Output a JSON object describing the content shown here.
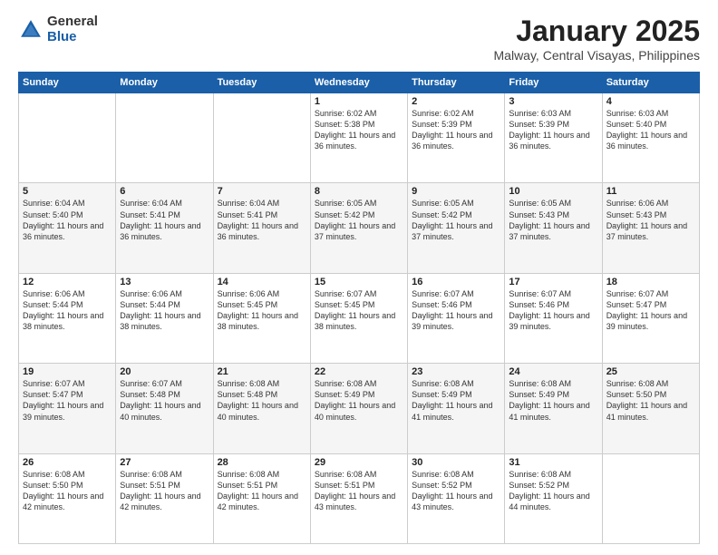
{
  "header": {
    "logo_general": "General",
    "logo_blue": "Blue",
    "month_title": "January 2025",
    "location": "Malway, Central Visayas, Philippines"
  },
  "days_of_week": [
    "Sunday",
    "Monday",
    "Tuesday",
    "Wednesday",
    "Thursday",
    "Friday",
    "Saturday"
  ],
  "weeks": [
    [
      {
        "day": "",
        "sunrise": "",
        "sunset": "",
        "daylight": ""
      },
      {
        "day": "",
        "sunrise": "",
        "sunset": "",
        "daylight": ""
      },
      {
        "day": "",
        "sunrise": "",
        "sunset": "",
        "daylight": ""
      },
      {
        "day": "1",
        "sunrise": "Sunrise: 6:02 AM",
        "sunset": "Sunset: 5:38 PM",
        "daylight": "Daylight: 11 hours and 36 minutes."
      },
      {
        "day": "2",
        "sunrise": "Sunrise: 6:02 AM",
        "sunset": "Sunset: 5:39 PM",
        "daylight": "Daylight: 11 hours and 36 minutes."
      },
      {
        "day": "3",
        "sunrise": "Sunrise: 6:03 AM",
        "sunset": "Sunset: 5:39 PM",
        "daylight": "Daylight: 11 hours and 36 minutes."
      },
      {
        "day": "4",
        "sunrise": "Sunrise: 6:03 AM",
        "sunset": "Sunset: 5:40 PM",
        "daylight": "Daylight: 11 hours and 36 minutes."
      }
    ],
    [
      {
        "day": "5",
        "sunrise": "Sunrise: 6:04 AM",
        "sunset": "Sunset: 5:40 PM",
        "daylight": "Daylight: 11 hours and 36 minutes."
      },
      {
        "day": "6",
        "sunrise": "Sunrise: 6:04 AM",
        "sunset": "Sunset: 5:41 PM",
        "daylight": "Daylight: 11 hours and 36 minutes."
      },
      {
        "day": "7",
        "sunrise": "Sunrise: 6:04 AM",
        "sunset": "Sunset: 5:41 PM",
        "daylight": "Daylight: 11 hours and 36 minutes."
      },
      {
        "day": "8",
        "sunrise": "Sunrise: 6:05 AM",
        "sunset": "Sunset: 5:42 PM",
        "daylight": "Daylight: 11 hours and 37 minutes."
      },
      {
        "day": "9",
        "sunrise": "Sunrise: 6:05 AM",
        "sunset": "Sunset: 5:42 PM",
        "daylight": "Daylight: 11 hours and 37 minutes."
      },
      {
        "day": "10",
        "sunrise": "Sunrise: 6:05 AM",
        "sunset": "Sunset: 5:43 PM",
        "daylight": "Daylight: 11 hours and 37 minutes."
      },
      {
        "day": "11",
        "sunrise": "Sunrise: 6:06 AM",
        "sunset": "Sunset: 5:43 PM",
        "daylight": "Daylight: 11 hours and 37 minutes."
      }
    ],
    [
      {
        "day": "12",
        "sunrise": "Sunrise: 6:06 AM",
        "sunset": "Sunset: 5:44 PM",
        "daylight": "Daylight: 11 hours and 38 minutes."
      },
      {
        "day": "13",
        "sunrise": "Sunrise: 6:06 AM",
        "sunset": "Sunset: 5:44 PM",
        "daylight": "Daylight: 11 hours and 38 minutes."
      },
      {
        "day": "14",
        "sunrise": "Sunrise: 6:06 AM",
        "sunset": "Sunset: 5:45 PM",
        "daylight": "Daylight: 11 hours and 38 minutes."
      },
      {
        "day": "15",
        "sunrise": "Sunrise: 6:07 AM",
        "sunset": "Sunset: 5:45 PM",
        "daylight": "Daylight: 11 hours and 38 minutes."
      },
      {
        "day": "16",
        "sunrise": "Sunrise: 6:07 AM",
        "sunset": "Sunset: 5:46 PM",
        "daylight": "Daylight: 11 hours and 39 minutes."
      },
      {
        "day": "17",
        "sunrise": "Sunrise: 6:07 AM",
        "sunset": "Sunset: 5:46 PM",
        "daylight": "Daylight: 11 hours and 39 minutes."
      },
      {
        "day": "18",
        "sunrise": "Sunrise: 6:07 AM",
        "sunset": "Sunset: 5:47 PM",
        "daylight": "Daylight: 11 hours and 39 minutes."
      }
    ],
    [
      {
        "day": "19",
        "sunrise": "Sunrise: 6:07 AM",
        "sunset": "Sunset: 5:47 PM",
        "daylight": "Daylight: 11 hours and 39 minutes."
      },
      {
        "day": "20",
        "sunrise": "Sunrise: 6:07 AM",
        "sunset": "Sunset: 5:48 PM",
        "daylight": "Daylight: 11 hours and 40 minutes."
      },
      {
        "day": "21",
        "sunrise": "Sunrise: 6:08 AM",
        "sunset": "Sunset: 5:48 PM",
        "daylight": "Daylight: 11 hours and 40 minutes."
      },
      {
        "day": "22",
        "sunrise": "Sunrise: 6:08 AM",
        "sunset": "Sunset: 5:49 PM",
        "daylight": "Daylight: 11 hours and 40 minutes."
      },
      {
        "day": "23",
        "sunrise": "Sunrise: 6:08 AM",
        "sunset": "Sunset: 5:49 PM",
        "daylight": "Daylight: 11 hours and 41 minutes."
      },
      {
        "day": "24",
        "sunrise": "Sunrise: 6:08 AM",
        "sunset": "Sunset: 5:49 PM",
        "daylight": "Daylight: 11 hours and 41 minutes."
      },
      {
        "day": "25",
        "sunrise": "Sunrise: 6:08 AM",
        "sunset": "Sunset: 5:50 PM",
        "daylight": "Daylight: 11 hours and 41 minutes."
      }
    ],
    [
      {
        "day": "26",
        "sunrise": "Sunrise: 6:08 AM",
        "sunset": "Sunset: 5:50 PM",
        "daylight": "Daylight: 11 hours and 42 minutes."
      },
      {
        "day": "27",
        "sunrise": "Sunrise: 6:08 AM",
        "sunset": "Sunset: 5:51 PM",
        "daylight": "Daylight: 11 hours and 42 minutes."
      },
      {
        "day": "28",
        "sunrise": "Sunrise: 6:08 AM",
        "sunset": "Sunset: 5:51 PM",
        "daylight": "Daylight: 11 hours and 42 minutes."
      },
      {
        "day": "29",
        "sunrise": "Sunrise: 6:08 AM",
        "sunset": "Sunset: 5:51 PM",
        "daylight": "Daylight: 11 hours and 43 minutes."
      },
      {
        "day": "30",
        "sunrise": "Sunrise: 6:08 AM",
        "sunset": "Sunset: 5:52 PM",
        "daylight": "Daylight: 11 hours and 43 minutes."
      },
      {
        "day": "31",
        "sunrise": "Sunrise: 6:08 AM",
        "sunset": "Sunset: 5:52 PM",
        "daylight": "Daylight: 11 hours and 44 minutes."
      },
      {
        "day": "",
        "sunrise": "",
        "sunset": "",
        "daylight": ""
      }
    ]
  ]
}
